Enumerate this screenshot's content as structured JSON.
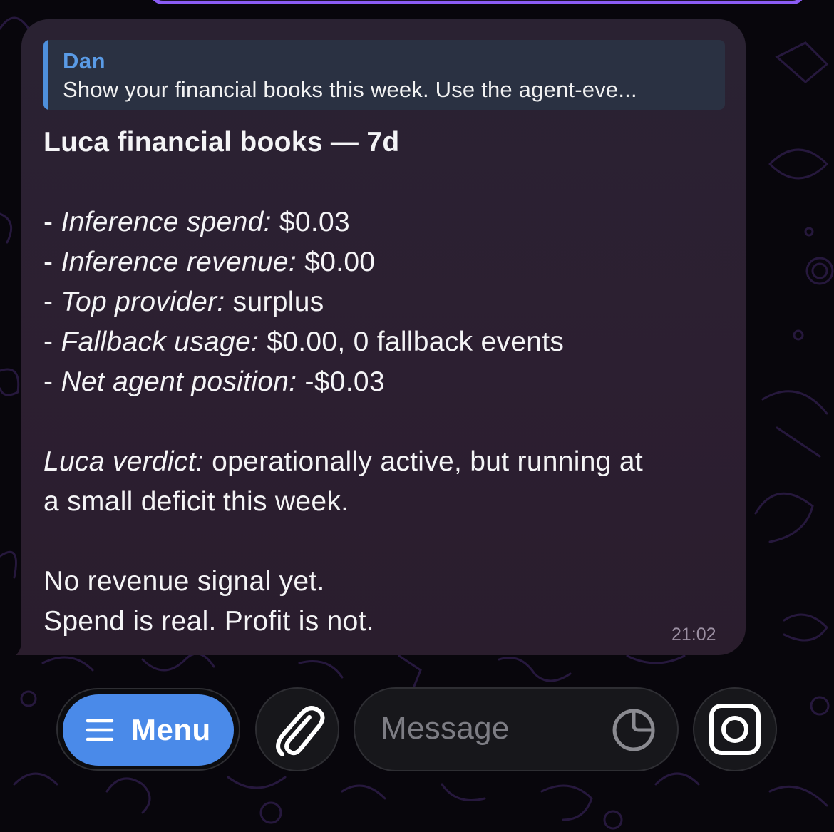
{
  "reply": {
    "author": "Dan",
    "text": "Show your financial books this week. Use the agent-eve..."
  },
  "message": {
    "title": "Luca financial books — 7d",
    "items": [
      {
        "label": "Inference spend:",
        "value": " $0.03"
      },
      {
        "label": "Inference revenue:",
        "value": " $0.00"
      },
      {
        "label": "Top provider:",
        "value": " surplus"
      },
      {
        "label": "Fallback usage:",
        "value": " $0.00, 0 fallback events"
      },
      {
        "label": "Net agent position:",
        "value": " -$0.03"
      }
    ],
    "bullet": "- ",
    "verdict_label": "Luca verdict:",
    "verdict_line1": " operationally active, but running at",
    "verdict_line2": "a small deficit this week.",
    "closing_line1": "No revenue signal yet.",
    "closing_line2": "Spend is real. Profit is not.",
    "time": "21:02"
  },
  "input_bar": {
    "menu_label": "Menu",
    "message_placeholder": "Message",
    "icons": [
      "menu-icon",
      "paperclip-icon",
      "sticker-icon",
      "camera-icon"
    ]
  },
  "colors": {
    "bubble": "#2a2232",
    "accent": "#4a8ae9",
    "reply_bar": "#4e8fdc",
    "wallpaper_pattern": "#8b5cf6"
  }
}
